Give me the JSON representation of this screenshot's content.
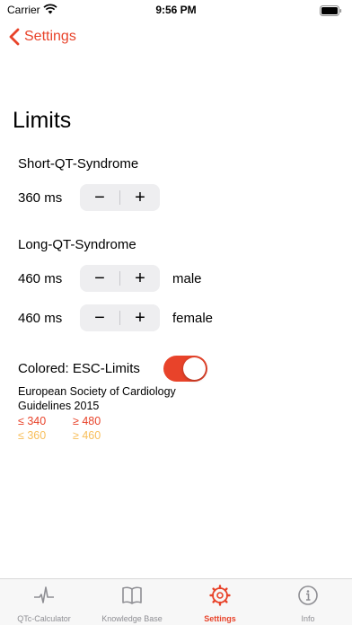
{
  "status": {
    "carrier": "Carrier",
    "time": "9:56 PM"
  },
  "nav": {
    "back_label": "Settings"
  },
  "page": {
    "title": "Limits"
  },
  "short_qt": {
    "label": "Short-QT-Syndrome",
    "value": "360 ms"
  },
  "long_qt": {
    "label": "Long-QT-Syndrome",
    "male": {
      "value": "460 ms",
      "gender": "male"
    },
    "female": {
      "value": "460 ms",
      "gender": "female"
    }
  },
  "stepper": {
    "minus": "−",
    "plus": "+"
  },
  "esc": {
    "toggle_label": "Colored: ESC-Limits",
    "toggle_on": true,
    "guideline": "European Society of Cardiology Guidelines 2015",
    "red_low": "≤ 340",
    "red_high": "≥ 480",
    "yellow_low": "≤ 360",
    "yellow_high": "≥ 460"
  },
  "tabs": [
    {
      "label": "QTc-Calculator",
      "icon": "ecg-wave-icon"
    },
    {
      "label": "Knowledge Base",
      "icon": "book-icon"
    },
    {
      "label": "Settings",
      "icon": "gear-icon",
      "active": true
    },
    {
      "label": "Info",
      "icon": "info-icon"
    }
  ],
  "colors": {
    "accent": "#e8432a",
    "yellow": "#f7be5a",
    "tab_inactive": "#8e8e93"
  }
}
